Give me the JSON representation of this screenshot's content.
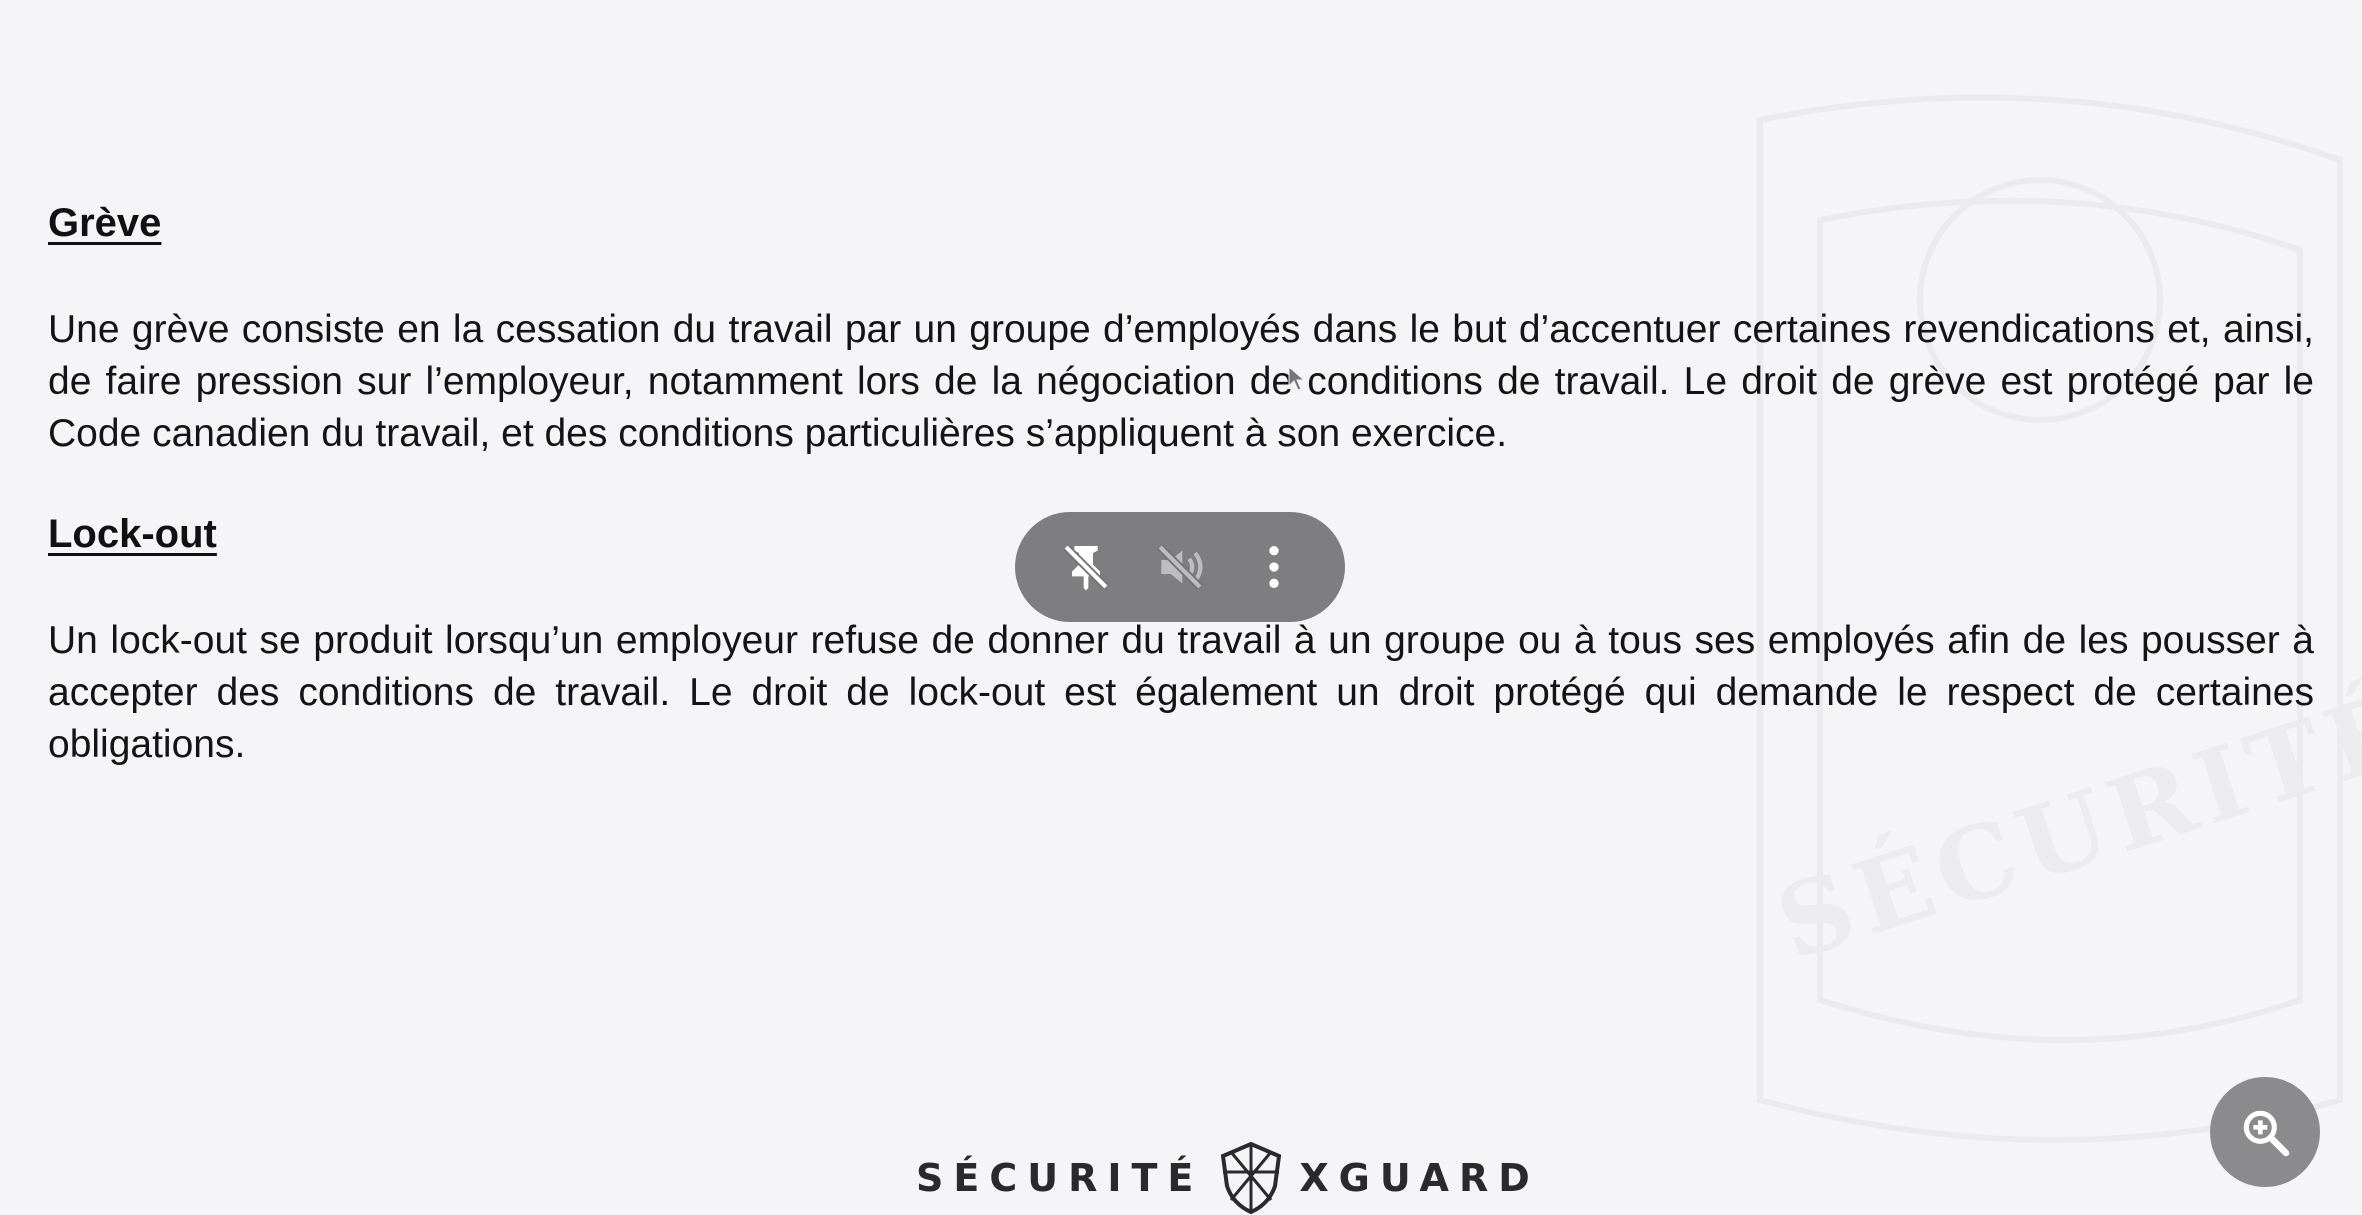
{
  "sections": [
    {
      "heading": "Grève",
      "body": "Une grève consiste en la cessation du travail par un groupe d’employés dans le but d’accentuer certaines revendications et, ainsi, de faire pression sur l’employeur, notamment lors de la négociation de conditions de travail. Le droit de grève est protégé par le Code canadien du travail, et des conditions particulières s’appliquent à son exercice."
    },
    {
      "heading": "Lock-out",
      "body": "Un lock-out se produit lorsqu’un employeur refuse de donner du travail à un groupe ou à tous ses employés afin de les pousser à accepter des conditions de travail. Le droit de lock-out est également un droit protégé qui demande le respect de certaines obligations."
    }
  ],
  "brand": {
    "left_word": "SÉCURITÉ",
    "right_word": "XGUARD"
  },
  "watermark": {
    "text": "SÉCURITÉ"
  },
  "toolbar": {
    "icons": [
      "pin-off-icon",
      "volume-off-icon",
      "more-vert-icon"
    ]
  },
  "zoom_button": {
    "icon": "zoom-in-icon"
  },
  "colors": {
    "background": "#f5f5f7",
    "toolbar": "#737376",
    "fab": "#8b8b8e",
    "text": "#141414"
  }
}
